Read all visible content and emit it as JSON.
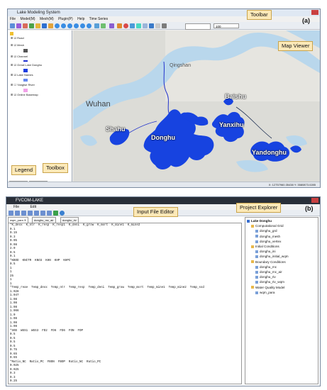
{
  "panel_a": {
    "label": "(a)",
    "window_title": "Lake Modeling System",
    "menu": [
      "File",
      "Model(M)",
      "Mesh(M)",
      "Plugin(P)",
      "Help",
      "Time Series"
    ],
    "toolbar_field_value": "100",
    "legend_items": [
      "Road",
      "Mesh",
      "Channel",
      "Great Lake Donghu",
      "Lake Names",
      "Yangtse River",
      "Online Basemap"
    ],
    "bottom_tabs": [
      "Legend",
      "Toolbox"
    ],
    "status_coords": "X: 12757960.35438  Y: 3580873.0285",
    "callouts": {
      "toolbar": "Toolbar",
      "map_viewer": "Map Viewer",
      "legend": "Legend",
      "toolbox": "Toolbox"
    },
    "map_labels": [
      "Shahu",
      "Donghu",
      "Yanxihu",
      "Baishu",
      "Yandonghu"
    ],
    "place_labels": [
      "Qingshan",
      "Wuhan"
    ]
  },
  "panel_b": {
    "label": "(b)",
    "window_title": "FVCOM-LAKE",
    "menu": [
      "File",
      "Edit"
    ],
    "tabs": [
      "wqm_para",
      "donghu_mc_air",
      "donghu_riv"
    ],
    "callouts": {
      "editor": "Input File Editor",
      "explorer": "Project Explorer"
    },
    "editor_lines": [
      "*K_deox  K_ntr  K_resp  K_resp1  K_deni  K_grow  K_mort  K_mine1  K_mine2",
      "0.1",
      "0.15",
      "0.3",
      "0.05",
      "0.08",
      "2.0",
      "0.5",
      "0.1",
      "*KBOD  KNITR  KNO3  KHN  KHP  KHPC",
      "0.5",
      "1",
      "1",
      "25",
      "1",
      "1",
      "*Temp_reae  Temp_deox  Temp_ntr  Temp_resp  Temp_deni  Temp_grow  Temp_mort  Temp_mine1  Temp_mine2  Temp_sod",
      "1.028",
      "1.047",
      "1.08",
      "1.08",
      "1.08",
      "1.066",
      "1.0",
      "1.08",
      "1.08",
      "1.08",
      "*SOD  WSS1  WSS3  FD2  FD6  FD6  FON  FOP",
      "0.5",
      "0.5",
      "0.5",
      "0.5",
      "0.75",
      "0.65",
      "0.65",
      "*Ratio_NC  Ratio_PC  FBON  FBOP  Ratio_NC  Ratio_PC",
      "0.025",
      "0.025",
      "0.3",
      "0.3",
      "0.25"
    ],
    "explorer_tree": [
      {
        "text": "Lake Donghu",
        "level": 0,
        "type": "root"
      },
      {
        "text": "Computational Grid",
        "level": 1,
        "type": "folder"
      },
      {
        "text": "donghu_grd",
        "level": 2,
        "type": "file"
      },
      {
        "text": "donghu_mesh",
        "level": 2,
        "type": "file"
      },
      {
        "text": "donghu_vertex",
        "level": 2,
        "type": "file"
      },
      {
        "text": "Initial Conditions",
        "level": 1,
        "type": "folder"
      },
      {
        "text": "donghu_ini",
        "level": 2,
        "type": "file"
      },
      {
        "text": "donghu_initial_wqm",
        "level": 2,
        "type": "file"
      },
      {
        "text": "Boundary Conditions",
        "level": 1,
        "type": "folder"
      },
      {
        "text": "donghu_mc",
        "level": 2,
        "type": "file"
      },
      {
        "text": "donghu_mc_air",
        "level": 2,
        "type": "file"
      },
      {
        "text": "donghu_riv",
        "level": 2,
        "type": "file"
      },
      {
        "text": "donghu_riv_wqm",
        "level": 2,
        "type": "file"
      },
      {
        "text": "Water Quality Model",
        "level": 1,
        "type": "folder"
      },
      {
        "text": "wqm_para",
        "level": 2,
        "type": "file"
      }
    ]
  }
}
